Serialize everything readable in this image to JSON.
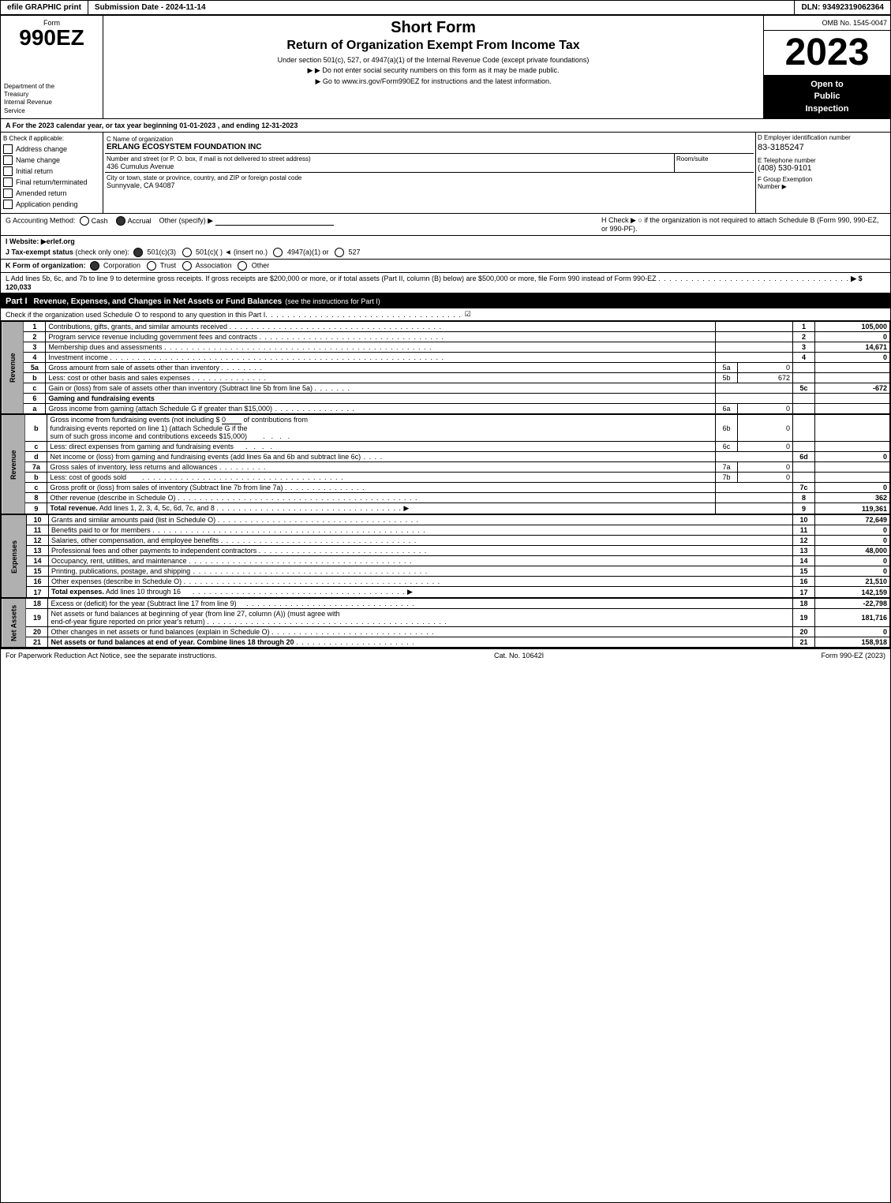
{
  "header": {
    "efile_label": "efile GRAPHIC print",
    "submission_label": "Submission Date - 2024-11-14",
    "dln_label": "DLN: 93492319062364"
  },
  "form": {
    "number": "990EZ",
    "short_form": "Short Form",
    "title": "Return of Organization Exempt From Income Tax",
    "subtitle": "Under section 501(c), 527, or 4947(a)(1) of the Internal Revenue Code (except private foundations)",
    "instruction1": "▶ Do not enter social security numbers on this form as it may be made public.",
    "instruction2": "▶ Go to www.irs.gov/Form990EZ for instructions and the latest information.",
    "omb": "OMB No. 1545-0047",
    "year": "2023",
    "open_label1": "Open to",
    "open_label2": "Public",
    "open_label3": "Inspection",
    "dept_line1": "Department of the",
    "dept_line2": "Treasury",
    "dept_line3": "Internal Revenue",
    "dept_line4": "Service"
  },
  "section_a": {
    "label": "A For the 2023 calendar year, or tax year beginning 01-01-2023 , and ending 12-31-2023"
  },
  "check_applicable": {
    "label": "B Check if applicable:",
    "address_change": "Address change",
    "name_change": "Name change",
    "initial_return": "Initial return",
    "final_return": "Final return/terminated",
    "amended_return": "Amended return",
    "application_pending": "Application pending"
  },
  "org": {
    "c_label": "C Name of organization",
    "name": "ERLANG ECOSYSTEM FOUNDATION INC",
    "address_label": "Number and street (or P. O. box, if mail is not delivered to street address)",
    "address": "436 Cumulus Avenue",
    "room_label": "Room/suite",
    "room": "",
    "city_label": "City or town, state or province, country, and ZIP or foreign postal code",
    "city": "Sunnyvale, CA  94087",
    "d_label": "D Employer identification number",
    "ein": "83-3185247",
    "e_label": "E Telephone number",
    "phone": "(408) 530-9101",
    "f_label": "F Group Exemption",
    "f_label2": "Number",
    "f_value": ""
  },
  "section_g": {
    "label": "G Accounting Method:",
    "cash": "Cash",
    "accrual": "Accrual",
    "accrual_checked": true,
    "other": "Other (specify) ▶",
    "other_value": ""
  },
  "section_h": {
    "label": "H Check ▶",
    "text": "○ if the organization is not required to attach Schedule B (Form 990, 990-EZ, or 990-PF)."
  },
  "section_i": {
    "label": "I Website: ▶erlef.org"
  },
  "section_j": {
    "label": "J Tax-exempt status",
    "text": "(check only one):",
    "opt1": "501(c)(3)",
    "opt1_checked": true,
    "opt2": "501(c)(",
    "opt2_suffix": ") ◄ (insert no.)",
    "opt3": "4947(a)(1) or",
    "opt4": "527"
  },
  "section_k": {
    "label": "K Form of organization:",
    "corp": "Corporation",
    "corp_checked": true,
    "trust": "Trust",
    "assoc": "Association",
    "other": "Other"
  },
  "section_l": {
    "label": "L Add lines 5b, 6c, and 7b to line 9 to determine gross receipts. If gross receipts are $200,000 or more, or if total assets (Part II, column (B) below) are $500,000 or more, file Form 990 instead of Form 990-EZ",
    "dots": "",
    "arrow": "▶ $",
    "value": "120,033"
  },
  "part1": {
    "label": "Part I",
    "title": "Revenue, Expenses, and Changes in Net Assets or Fund Balances",
    "subtitle": "(see the instructions for Part I)",
    "check_text": "Check if the organization used Schedule O to respond to any question in this Part I",
    "rows": [
      {
        "num": "1",
        "desc": "Contributions, gifts, grants, and similar amounts received",
        "box": "1",
        "amount": "105,000"
      },
      {
        "num": "2",
        "desc": "Program service revenue including government fees and contracts",
        "box": "2",
        "amount": "0"
      },
      {
        "num": "3",
        "desc": "Membership dues and assessments",
        "box": "3",
        "amount": "14,671"
      },
      {
        "num": "4",
        "desc": "Investment income",
        "box": "4",
        "amount": "0"
      },
      {
        "num": "5a",
        "desc": "Gross amount from sale of assets other than inventory",
        "line_lbl": "5a",
        "mid_val": "0"
      },
      {
        "num": "5b",
        "desc": "Less: cost or other basis and sales expenses",
        "line_lbl": "5b",
        "mid_val": "672"
      },
      {
        "num": "5c",
        "desc": "Gain or (loss) from sale of assets other than inventory (Subtract line 5b from line 5a)",
        "box": "5c",
        "amount": "-672"
      },
      {
        "num": "6",
        "desc": "Gaming and fundraising events",
        "box": "",
        "amount": ""
      },
      {
        "num": "6a",
        "desc": "Gross income from gaming (attach Schedule G if greater than $15,000)",
        "line_lbl": "6a",
        "mid_val": "0"
      },
      {
        "num": "6b",
        "desc": "Gross income from fundraising events (not including $ 0 of contributions from fundraising events reported on line 1) (attach Schedule G if the sum of such gross income and contributions exceeds $15,000)",
        "line_lbl": "6b",
        "mid_val": "0"
      },
      {
        "num": "6c",
        "desc": "Less: direct expenses from gaming and fundraising events",
        "line_lbl": "6c",
        "mid_val": "0"
      },
      {
        "num": "6d",
        "desc": "Net income or (loss) from gaming and fundraising events (add lines 6a and 6b and subtract line 6c)",
        "box": "6d",
        "amount": "0"
      },
      {
        "num": "7a",
        "desc": "Gross sales of inventory, less returns and allowances",
        "line_lbl": "7a",
        "mid_val": "0"
      },
      {
        "num": "7b",
        "desc": "Less: cost of goods sold",
        "line_lbl": "7b",
        "mid_val": "0"
      },
      {
        "num": "7c",
        "desc": "Gross profit or (loss) from sales of inventory (Subtract line 7b from line 7a)",
        "box": "7c",
        "amount": "0"
      },
      {
        "num": "8",
        "desc": "Other revenue (describe in Schedule O)",
        "box": "8",
        "amount": "362"
      },
      {
        "num": "9",
        "desc": "Total revenue. Add lines 1, 2, 3, 4, 5c, 6d, 7c, and 8",
        "box": "9",
        "amount": "119,361",
        "bold": true,
        "arrow": true
      }
    ]
  },
  "expenses_rows": [
    {
      "num": "10",
      "desc": "Grants and similar amounts paid (list in Schedule O)",
      "box": "10",
      "amount": "72,649"
    },
    {
      "num": "11",
      "desc": "Benefits paid to or for members",
      "box": "11",
      "amount": "0"
    },
    {
      "num": "12",
      "desc": "Salaries, other compensation, and employee benefits",
      "box": "12",
      "amount": "0"
    },
    {
      "num": "13",
      "desc": "Professional fees and other payments to independent contractors",
      "box": "13",
      "amount": "48,000"
    },
    {
      "num": "14",
      "desc": "Occupancy, rent, utilities, and maintenance",
      "box": "14",
      "amount": "0"
    },
    {
      "num": "15",
      "desc": "Printing, publications, postage, and shipping",
      "box": "15",
      "amount": "0"
    },
    {
      "num": "16",
      "desc": "Other expenses (describe in Schedule O)",
      "box": "16",
      "amount": "21,510"
    },
    {
      "num": "17",
      "desc": "Total expenses. Add lines 10 through 16",
      "box": "17",
      "amount": "142,159",
      "bold": true,
      "arrow": true
    }
  ],
  "net_assets_rows": [
    {
      "num": "18",
      "desc": "Excess or (deficit) for the year (Subtract line 17 from line 9)",
      "box": "18",
      "amount": "-22,798"
    },
    {
      "num": "19",
      "desc": "Net assets or fund balances at beginning of year (from line 27, column (A)) (must agree with end-of-year figure reported on prior year's return)",
      "box": "19",
      "amount": "181,716"
    },
    {
      "num": "20",
      "desc": "Other changes in net assets or fund balances (explain in Schedule O)",
      "box": "20",
      "amount": "0"
    },
    {
      "num": "21",
      "desc": "Net assets or fund balances at end of year. Combine lines 18 through 20",
      "box": "21",
      "amount": "158,918",
      "bold": true
    }
  ],
  "footer": {
    "paperwork": "For Paperwork Reduction Act Notice, see the separate instructions.",
    "cat": "Cat. No. 10642I",
    "form_label": "Form 990-EZ (2023)"
  }
}
